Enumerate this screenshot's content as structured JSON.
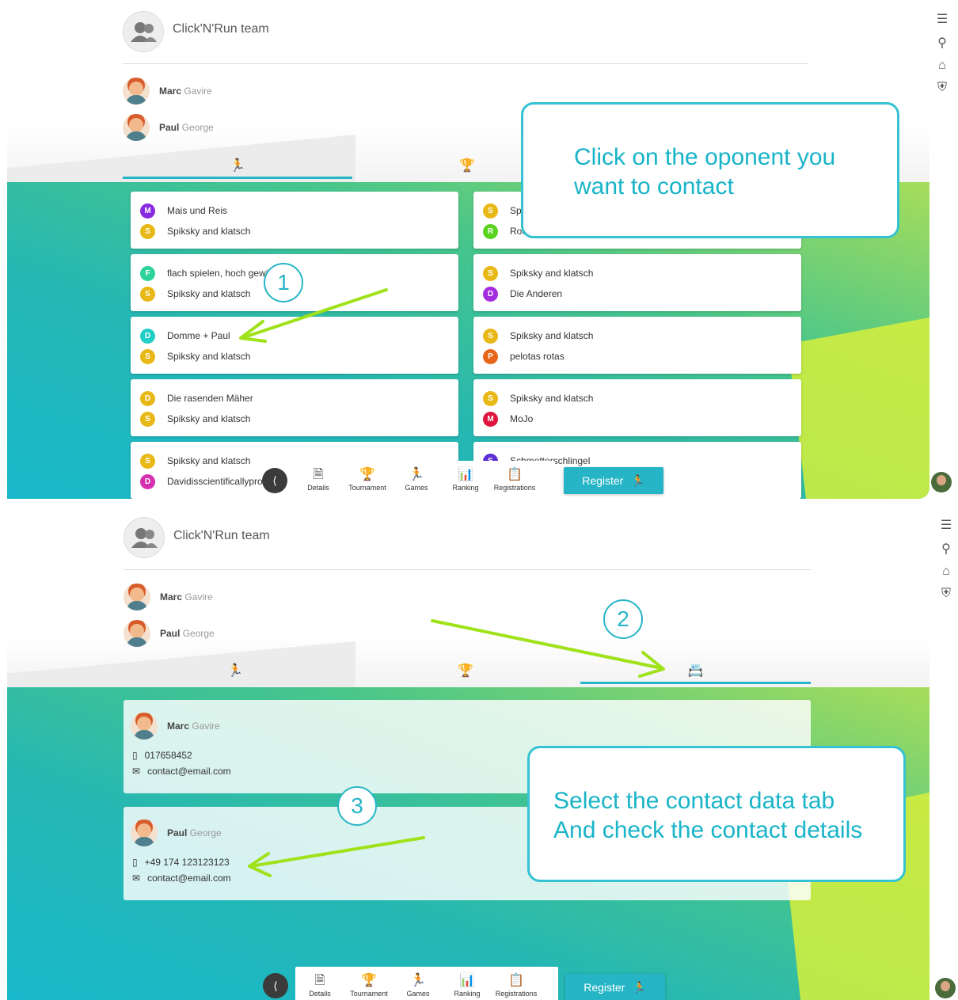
{
  "team": {
    "name": "Click'N'Run team"
  },
  "members": [
    {
      "first": "Marc",
      "last": "Gavire"
    },
    {
      "first": "Paul",
      "last": "George"
    }
  ],
  "colors": {
    "accent": "#26b5c6",
    "callout_text": "#19b4c8",
    "arrow": "#9fe21a"
  },
  "tabs": [
    {
      "icon": "runner-icon",
      "glyph": "🏃"
    },
    {
      "icon": "trophy-icon",
      "glyph": "🏆"
    },
    {
      "icon": "contact-card-icon",
      "glyph": "📇"
    }
  ],
  "games": {
    "left": [
      {
        "a": {
          "letter": "M",
          "name": "Mais und Reis",
          "color": "#8a2be2"
        },
        "b": {
          "letter": "S",
          "name": "Spiksky and klatsch",
          "color": "#e8b816"
        }
      },
      {
        "a": {
          "letter": "F",
          "name": "flach spielen, hoch gewinnen",
          "color": "#2ed39a"
        },
        "b": {
          "letter": "S",
          "name": "Spiksky and klatsch",
          "color": "#e8b816"
        }
      },
      {
        "a": {
          "letter": "D",
          "name": "Domme + Paul",
          "color": "#22cfc7"
        },
        "b": {
          "letter": "S",
          "name": "Spiksky and klatsch",
          "color": "#e8b816"
        }
      },
      {
        "a": {
          "letter": "D",
          "name": "Die rasenden Mäher",
          "color": "#e8b816"
        },
        "b": {
          "letter": "S",
          "name": "Spiksky and klatsch",
          "color": "#e8b816"
        }
      },
      {
        "a": {
          "letter": "S",
          "name": "Spiksky and klatsch",
          "color": "#e8b816"
        },
        "b": {
          "letter": "D",
          "name": "Davidisscientificallyproven",
          "color": "#d62fb0"
        }
      }
    ],
    "right": [
      {
        "a": {
          "letter": "S",
          "name": "Sp",
          "color": "#e8b816"
        },
        "b": {
          "letter": "R",
          "name": "Roc",
          "color": "#5bd321"
        }
      },
      {
        "a": {
          "letter": "S",
          "name": "Spiksky and klatsch",
          "color": "#e8b816"
        },
        "b": {
          "letter": "D",
          "name": "Die Anderen",
          "color": "#a42de0"
        }
      },
      {
        "a": {
          "letter": "S",
          "name": "Spiksky and klatsch",
          "color": "#e8b816"
        },
        "b": {
          "letter": "P",
          "name": "pelotas rotas",
          "color": "#e8661a"
        }
      },
      {
        "a": {
          "letter": "S",
          "name": "Spiksky and klatsch",
          "color": "#e8b816"
        },
        "b": {
          "letter": "M",
          "name": "MoJo",
          "color": "#e0153e"
        }
      },
      {
        "a": {
          "letter": "S",
          "name": "Schmetterschlingel",
          "color": "#5b2dd6"
        },
        "b": {
          "letter": "",
          "name": "",
          "color": "#ffffff"
        }
      }
    ]
  },
  "contacts": [
    {
      "first": "Marc",
      "last": "Gavire",
      "phone": "017658452",
      "email": "contact@email.com"
    },
    {
      "first": "Paul",
      "last": "George",
      "phone": "+49 174 123123123",
      "email": "contact@email.com"
    }
  ],
  "bottom_nav": [
    {
      "label": "Details",
      "icon": "document-icon",
      "glyph": "🗎"
    },
    {
      "label": "Tournament",
      "icon": "trophy-icon",
      "glyph": "🏆"
    },
    {
      "label": "Games",
      "icon": "runner-icon",
      "glyph": "🏃"
    },
    {
      "label": "Ranking",
      "icon": "ranking-icon",
      "glyph": "📊"
    },
    {
      "label": "Registrations",
      "icon": "clipboard-icon",
      "glyph": "📋"
    }
  ],
  "register_label": "Register",
  "callouts": {
    "one": [
      "Click on the oponent you",
      "want to contact"
    ],
    "two": [
      "Select the contact data tab",
      "And check the contact details"
    ]
  },
  "steps": [
    "1",
    "2",
    "3"
  ]
}
